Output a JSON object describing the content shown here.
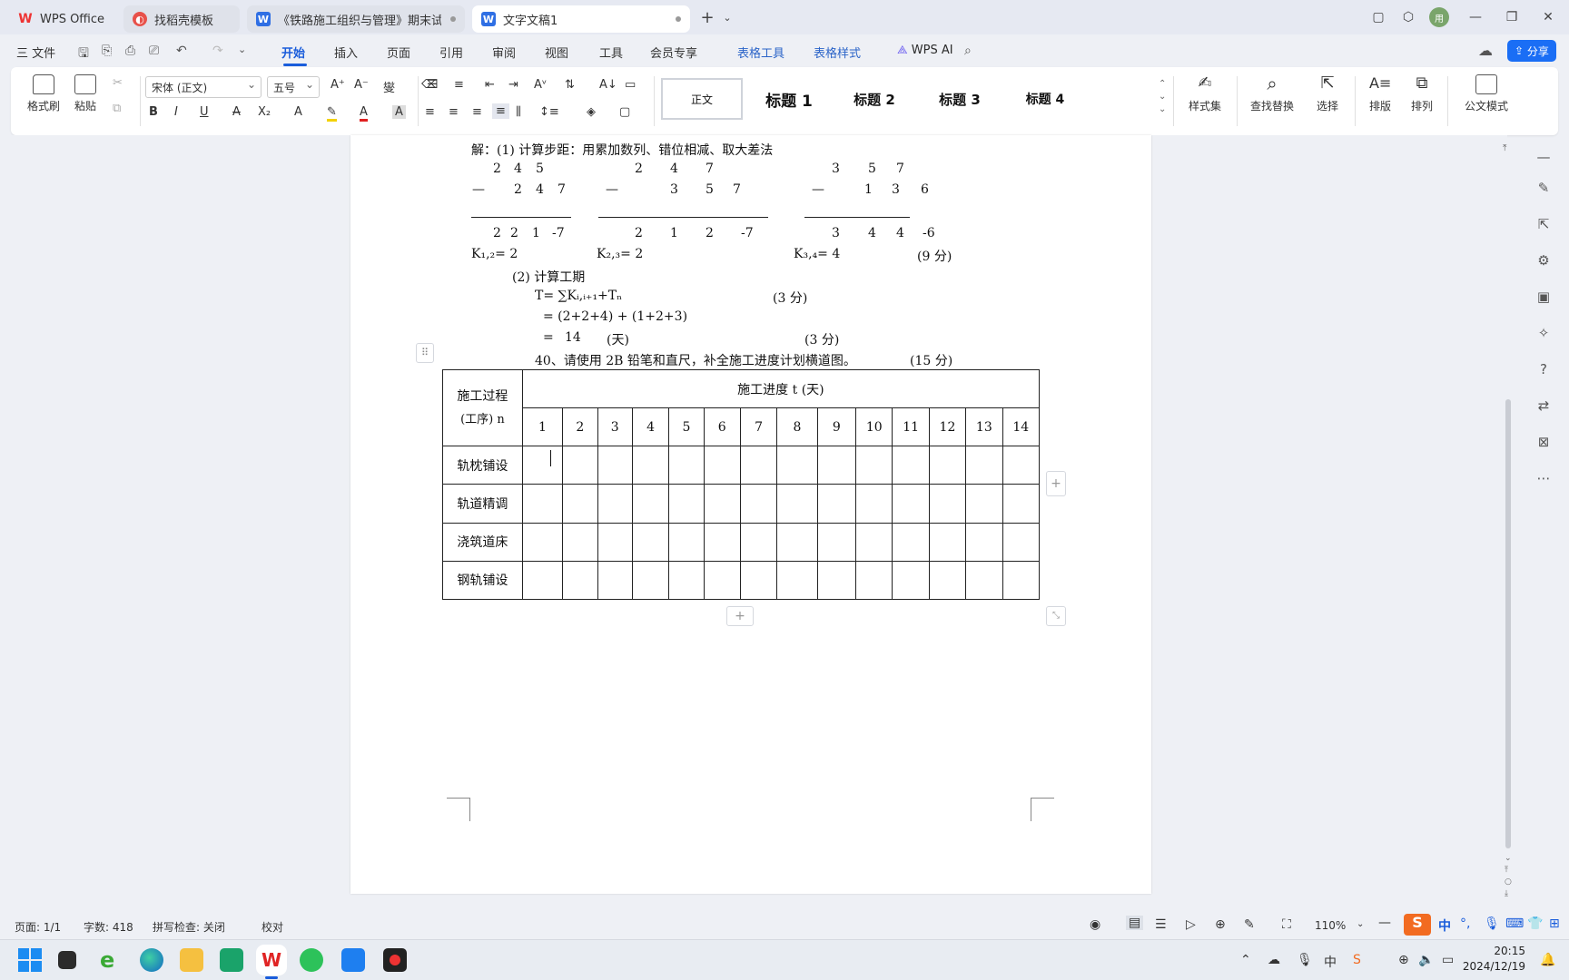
{
  "titlebar": {
    "tabs": [
      {
        "label": "WPS Office",
        "icon": "wps-logo-icon",
        "active": false
      },
      {
        "label": "找稻壳模板",
        "icon": "docer-icon",
        "active": false
      },
      {
        "label": "《铁路施工组织与管理》期末试卷(",
        "icon": "word-doc-icon",
        "active": false
      },
      {
        "label": "文字文稿1",
        "icon": "word-doc-icon",
        "active": true
      }
    ],
    "new_tab": "+",
    "window_controls": {
      "minimize": "—",
      "restore": "❐",
      "close": "✕"
    },
    "avatar_text": "用"
  },
  "menubar": {
    "file_menu": "三 文件",
    "tabs": [
      "开始",
      "插入",
      "页面",
      "引用",
      "审阅",
      "视图",
      "工具",
      "会员专享",
      "表格工具",
      "表格样式"
    ],
    "active_tab": "开始",
    "wps_ai": "WPS AI",
    "share": "分享"
  },
  "ribbon": {
    "format_painter": "格式刷",
    "paste": "粘贴",
    "font_name": "宋体 (正文)",
    "font_size": "五号",
    "styles": [
      "正文",
      "标题 1",
      "标题 2",
      "标题 3",
      "标题 4"
    ],
    "style_set": "样式集",
    "find_replace": "查找替换",
    "select": "选择",
    "typeset": "排版",
    "arrange": "排列",
    "official_mode": "公文模式"
  },
  "document": {
    "line1": "解：(1) 计算步距：用累加数列、错位相减、取大差法",
    "seq1_top": [
      "2",
      "4",
      "5"
    ],
    "seq1_bot": [
      "—",
      "2",
      "4",
      "7"
    ],
    "seq1_res": [
      "2",
      "2",
      "1",
      "-7"
    ],
    "seq2_top": [
      "2",
      "4",
      "7"
    ],
    "seq2_bot": [
      "—",
      "3",
      "5",
      "7"
    ],
    "seq2_res": [
      "2",
      "1",
      "2",
      "-7"
    ],
    "seq3_top": [
      "3",
      "5",
      "7"
    ],
    "seq3_bot": [
      "—",
      "1",
      "3",
      "6"
    ],
    "seq3_res": [
      "3",
      "4",
      "4",
      "-6"
    ],
    "k12": "K₁,₂= 2",
    "k23": "K₂,₃= 2",
    "k34": "K₃,₄= 4",
    "score9": "(9 分)",
    "step2": "(2) 计算工期",
    "formula": "T= ∑Kᵢ,ᵢ₊₁+Tₙ",
    "score3a": "(3 分)",
    "eq1": "= (2+2+4) + (1+2+3)",
    "eq2_eq": "=",
    "eq2_val": "14",
    "eq2_unit": "(天)",
    "score3b": "(3 分)",
    "q40": "40、请使用 2B 铅笔和直尺，补全施工进度计划横道图。",
    "score15": "(15 分)"
  },
  "schedule_table": {
    "header_process": "施工过程",
    "header_process2": "(工序) n",
    "header_progress": "施工进度 t (天)",
    "days": [
      "1",
      "2",
      "3",
      "4",
      "5",
      "6",
      "7",
      "8",
      "9",
      "10",
      "11",
      "12",
      "13",
      "14"
    ],
    "rows": [
      "轨枕铺设",
      "轨道精调",
      "浇筑道床",
      "钢轨铺设"
    ]
  },
  "statusbar": {
    "page": "页面: 1/1",
    "words": "字数: 418",
    "spell": "拼写检查: 关闭",
    "proof": "校对",
    "zoom": "110%"
  },
  "taskbar": {
    "clock_time": "20:15",
    "clock_date": "2024/12/19",
    "ime": "中"
  }
}
